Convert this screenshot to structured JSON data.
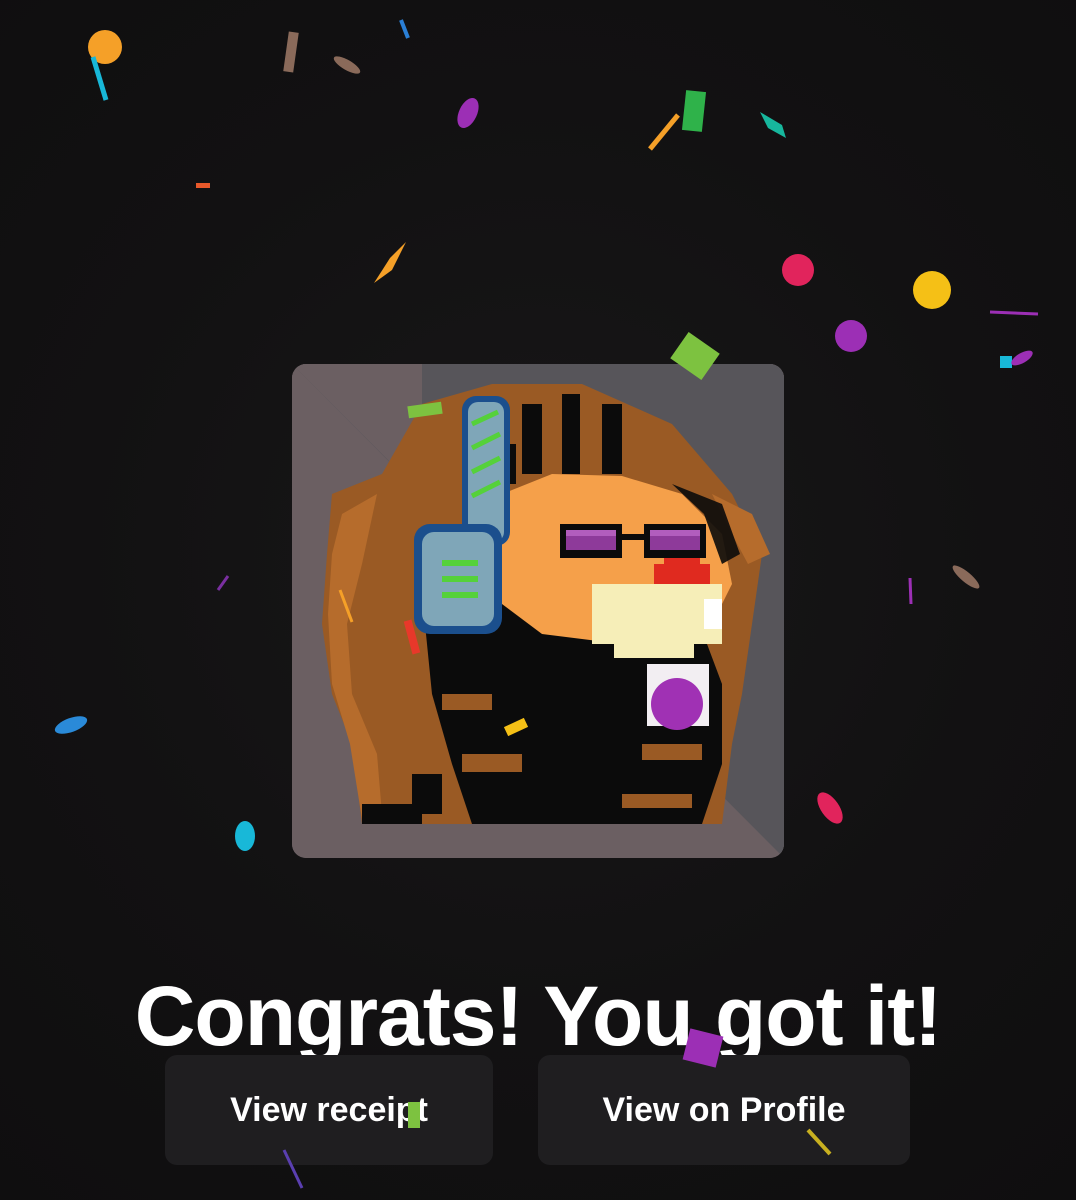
{
  "headline": "Congrats! You got it!",
  "buttons": {
    "view_receipt": "View receipt",
    "view_on_profile": "View on Profile"
  },
  "nft": {
    "description": "pixel-art cat with headphones and sunglasses"
  },
  "colors": {
    "background": "#121112",
    "button_bg": "#1f1e20",
    "text": "#ffffff",
    "card_bg": "#6b5f62"
  },
  "icons": {
    "confetti": "confetti-icon"
  }
}
